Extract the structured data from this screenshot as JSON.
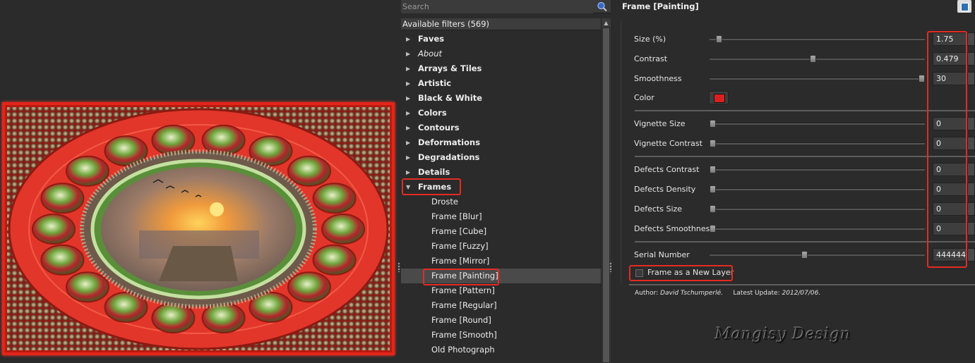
{
  "search": {
    "placeholder": "Search"
  },
  "filters_header": "Available filters (569)",
  "tree": {
    "categories": [
      {
        "label": "Faves",
        "style": "cat"
      },
      {
        "label": "About",
        "style": "italic"
      },
      {
        "label": "Arrays & Tiles",
        "style": "cat"
      },
      {
        "label": "Artistic",
        "style": "cat"
      },
      {
        "label": "Black & White",
        "style": "cat"
      },
      {
        "label": "Colors",
        "style": "cat"
      },
      {
        "label": "Contours",
        "style": "cat"
      },
      {
        "label": "Deformations",
        "style": "cat"
      },
      {
        "label": "Degradations",
        "style": "cat"
      },
      {
        "label": "Details",
        "style": "cat"
      },
      {
        "label": "Frames",
        "style": "cat",
        "expanded": true
      }
    ],
    "frames_items": [
      {
        "label": "Droste"
      },
      {
        "label": "Frame [Blur]"
      },
      {
        "label": "Frame [Cube]"
      },
      {
        "label": "Frame [Fuzzy]"
      },
      {
        "label": "Frame [Mirror]"
      },
      {
        "label": "Frame [Painting]",
        "selected": true
      },
      {
        "label": "Frame [Pattern]"
      },
      {
        "label": "Frame [Regular]"
      },
      {
        "label": "Frame [Round]"
      },
      {
        "label": "Frame [Smooth]"
      },
      {
        "label": "Old Photograph"
      }
    ]
  },
  "filter": {
    "title": "Frame [Painting]",
    "params": {
      "size": {
        "label": "Size (%)",
        "value": "1.75",
        "level": 0.03
      },
      "contrast": {
        "label": "Contrast",
        "value": "0.479",
        "level": 0.48
      },
      "smoothness": {
        "label": "Smoothness",
        "value": "30",
        "level": 1.0
      },
      "color": {
        "label": "Color",
        "hex": "#d82020"
      },
      "vignette_size": {
        "label": "Vignette Size",
        "value": "0",
        "level": 0
      },
      "vignette_contrast": {
        "label": "Vignette Contrast",
        "value": "0",
        "level": 0
      },
      "defects_contrast": {
        "label": "Defects Contrast",
        "value": "0",
        "level": 0
      },
      "defects_density": {
        "label": "Defects Density",
        "value": "0",
        "level": 0
      },
      "defects_size": {
        "label": "Defects Size",
        "value": "0",
        "level": 0
      },
      "defects_smoothness": {
        "label": "Defects Smoothness",
        "value": "0",
        "level": 0
      },
      "serial_number": {
        "label": "Serial Number",
        "value": "444444",
        "level": 0.44
      }
    },
    "new_layer": {
      "label": "Frame as a New Layer",
      "checked": false
    },
    "author_label": "Author:",
    "author": "David Tschumperlé.",
    "update_label": "Latest Update:",
    "update": "2012/07/06."
  },
  "watermark": "Mangisy Design",
  "colors": {
    "accent_red": "#e32b22",
    "frame_red": "#e5251a",
    "panel_bg": "#2b2b2b"
  }
}
